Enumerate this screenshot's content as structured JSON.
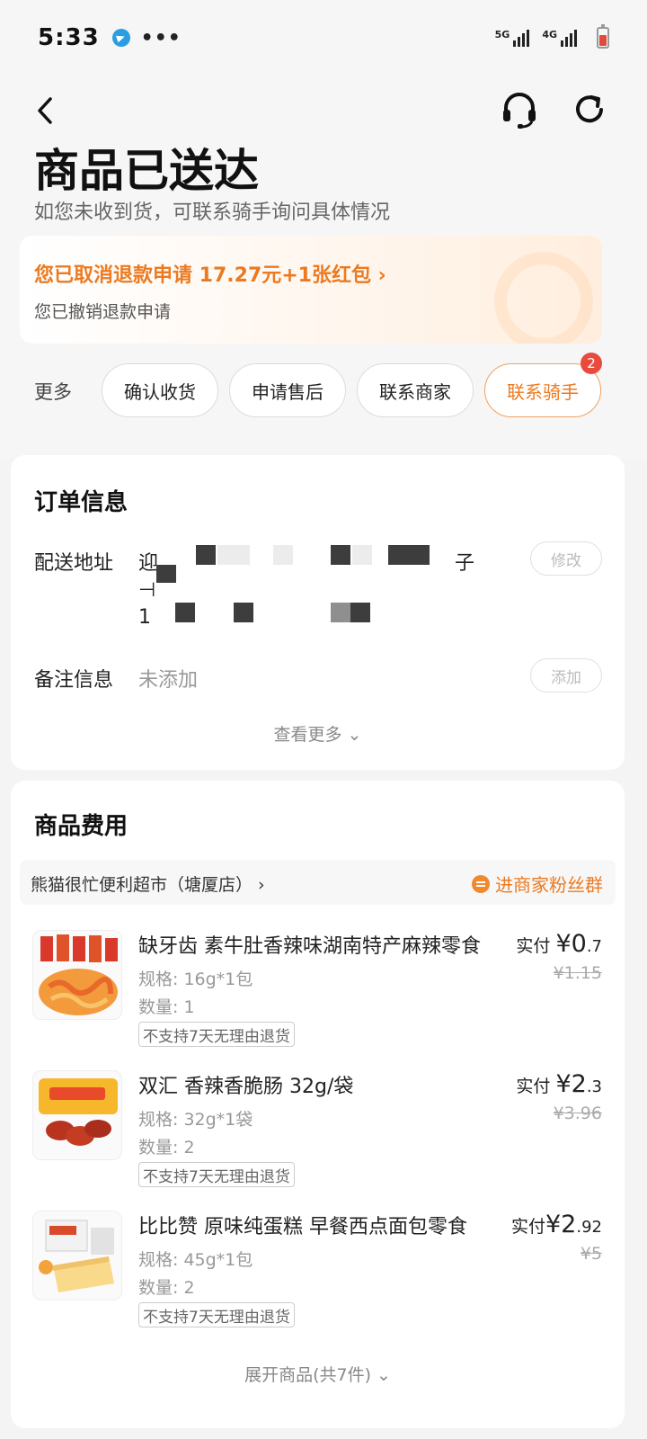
{
  "status_bar": {
    "time": "5:33",
    "dots": "•••",
    "net1": "5G",
    "net2": "4G"
  },
  "header": {
    "title": "商品已送达",
    "subtitle": "如您未收到货，可联系骑手询问具体情况"
  },
  "refund": {
    "line1": "您已取消退款申请 17.27元+1张红包 ›",
    "line2": "您已撤销退款申请"
  },
  "actions": {
    "more": "更多",
    "confirm": "确认收货",
    "after_sale": "申请售后",
    "contact_merchant": "联系商家",
    "contact_rider": "联系骑手",
    "rider_badge": "2"
  },
  "order_info": {
    "title": "订单信息",
    "address_label": "配送地址",
    "address_start": "迎",
    "address_tail": "子",
    "address_line2": "⊣",
    "address_line3": "1",
    "modify_btn": "修改",
    "note_label": "备注信息",
    "note_value": "未添加",
    "add_btn": "添加",
    "see_more": "查看更多 ⌄"
  },
  "goods": {
    "title": "商品费用",
    "store_name": "熊猫很忙便利超市（塘厦店） ›",
    "fan_group": "进商家粉丝群",
    "pay_label": "实付",
    "items": [
      {
        "name": "缺牙齿 素牛肚香辣味湖南特产麻辣零食",
        "spec": "规格: 16g*1包",
        "qty": "数量: 1",
        "tag": "不支持7天无理由退货",
        "price_int": "¥0",
        "price_dec": ".7",
        "orig": "¥1.15"
      },
      {
        "name": "双汇 香辣香脆肠 32g/袋",
        "spec": "规格: 32g*1袋",
        "qty": "数量: 2",
        "tag": "不支持7天无理由退货",
        "price_int": "¥2",
        "price_dec": ".3",
        "orig": "¥3.96"
      },
      {
        "name": "比比赞 原味纯蛋糕 早餐西点面包零食",
        "spec": "规格: 45g*1包",
        "qty": "数量: 2",
        "tag": "不支持7天无理由退货",
        "price_int": "¥2",
        "price_dec": ".92",
        "orig": "¥5"
      }
    ],
    "expand": "展开商品(共7件) ⌄"
  },
  "colors": {
    "accent": "#ec7a20",
    "badge": "#e94a3e"
  }
}
